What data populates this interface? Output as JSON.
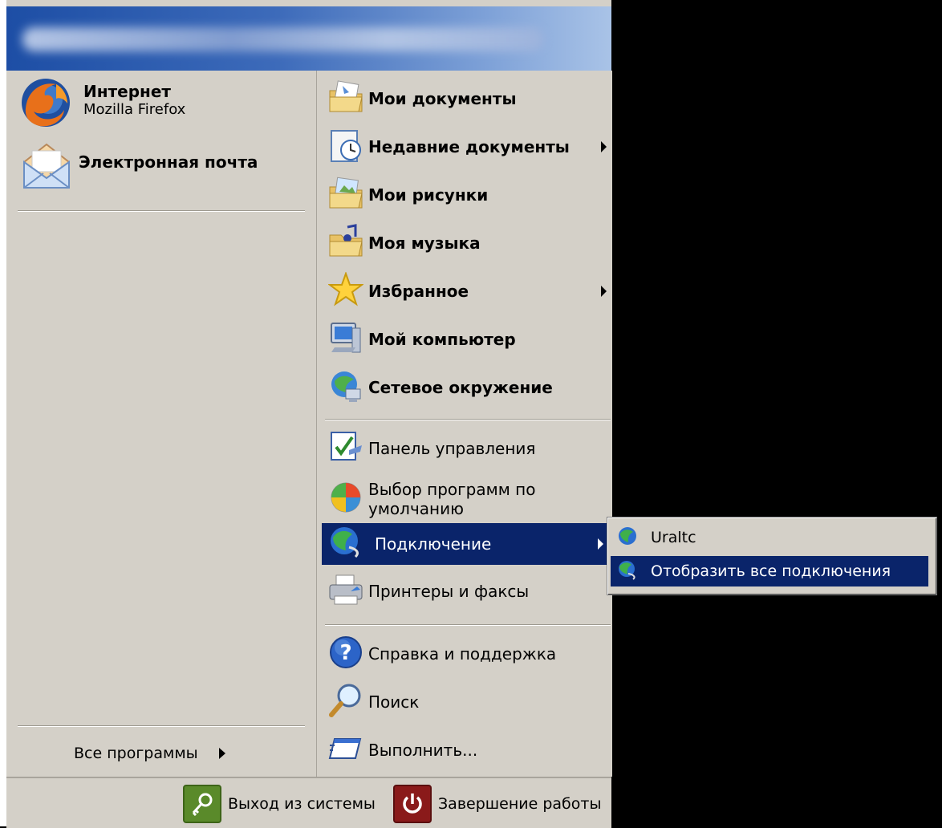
{
  "user_name": "",
  "pinned": [
    {
      "label": "Интернет",
      "sublabel": "Mozilla Firefox",
      "icon": "firefox-icon"
    },
    {
      "label": "Электронная почта",
      "icon": "email-icon"
    }
  ],
  "all_programs": {
    "label": "Все программы"
  },
  "places": [
    {
      "label": "Мои документы",
      "icon": "my-documents-icon"
    },
    {
      "label": "Недавние документы",
      "icon": "recent-documents-icon",
      "submenu": true
    },
    {
      "label": "Мои рисунки",
      "icon": "my-pictures-icon"
    },
    {
      "label": "Моя музыка",
      "icon": "my-music-icon"
    },
    {
      "label": "Избранное",
      "icon": "favorites-star-icon",
      "submenu": true
    },
    {
      "label": "Мой компьютер",
      "icon": "my-computer-icon"
    },
    {
      "label": "Сетевое окружение",
      "icon": "network-icon"
    }
  ],
  "settings": [
    {
      "label": "Панель управления",
      "icon": "control-panel-icon"
    },
    {
      "label": "Выбор программ по",
      "label2": "умолчанию",
      "icon": "default-programs-icon"
    },
    {
      "label": "Подключение",
      "icon": "connect-globe-icon",
      "submenu": true,
      "highlighted": true
    },
    {
      "label": "Принтеры и факсы",
      "icon": "printer-icon"
    }
  ],
  "help": [
    {
      "label": "Справка и поддержка",
      "icon": "help-icon"
    },
    {
      "label": "Поиск",
      "icon": "search-magnifier-icon"
    },
    {
      "label": "Выполнить...",
      "icon": "run-icon"
    }
  ],
  "connect_submenu": [
    {
      "label": "Uraltc",
      "icon": "globe-icon"
    },
    {
      "label": "Отобразить все подключения",
      "icon": "globe-connection-icon",
      "highlighted": true
    }
  ],
  "footer": {
    "logoff": "Выход из системы",
    "shutdown": "Завершение работы"
  },
  "colors": {
    "menu_bg": "#d4d0c8",
    "highlight": "#0a246a",
    "header": "#3d6bba"
  }
}
